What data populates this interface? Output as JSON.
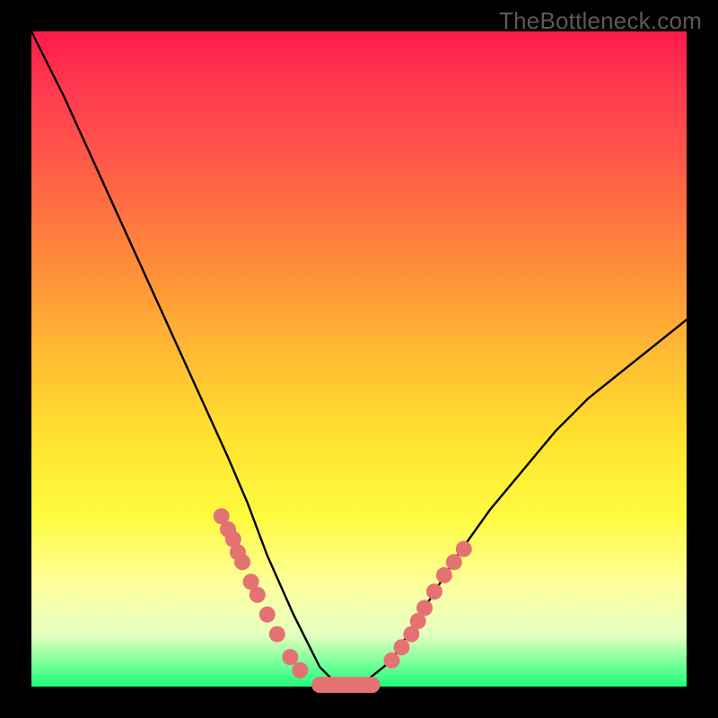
{
  "watermark": "TheBottleneck.com",
  "chart_data": {
    "type": "line",
    "title": "",
    "xlabel": "",
    "ylabel": "",
    "xlim": [
      0,
      100
    ],
    "ylim": [
      0,
      100
    ],
    "curve": {
      "name": "bottleneck-curve",
      "x": [
        0,
        5,
        10,
        15,
        20,
        25,
        30,
        33,
        36,
        40,
        44,
        47,
        50,
        55,
        60,
        65,
        70,
        75,
        80,
        85,
        90,
        95,
        100
      ],
      "y": [
        100,
        90,
        79,
        68,
        57,
        46,
        35,
        28,
        20,
        11,
        3,
        0,
        0,
        4,
        12,
        20,
        27,
        33,
        39,
        44,
        48,
        52,
        56
      ]
    },
    "series": [
      {
        "name": "left-cluster",
        "x": [
          29.0,
          30.0,
          30.8,
          31.5,
          32.2,
          33.5,
          34.5,
          36.0,
          37.5,
          39.5,
          41.0
        ],
        "y": [
          26.0,
          24.0,
          22.5,
          20.5,
          19.0,
          16.0,
          14.0,
          11.0,
          8.0,
          4.5,
          2.5
        ]
      },
      {
        "name": "valley-flat",
        "x": [
          44.0,
          46.0,
          48.0,
          50.0,
          52.0
        ],
        "y": [
          0.0,
          0.0,
          0.0,
          0.0,
          0.5
        ]
      },
      {
        "name": "right-cluster",
        "x": [
          55.0,
          56.5,
          58.0,
          59.0,
          60.0,
          61.5,
          63.0,
          64.5,
          66.0
        ],
        "y": [
          4.0,
          6.0,
          8.0,
          10.0,
          12.0,
          14.5,
          17.0,
          19.0,
          21.0
        ]
      }
    ],
    "background": {
      "type": "vertical-gradient",
      "stops": [
        {
          "offset": 0,
          "color": "#ff1a4a"
        },
        {
          "offset": 50,
          "color": "#ffc933"
        },
        {
          "offset": 85,
          "color": "#fdff90"
        },
        {
          "offset": 100,
          "color": "#1eff7a"
        }
      ]
    }
  }
}
